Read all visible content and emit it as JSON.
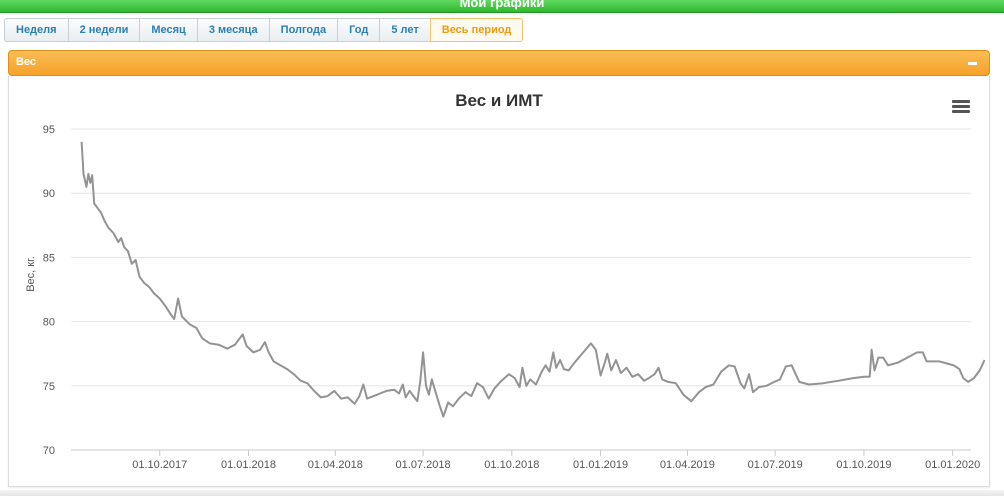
{
  "header": {
    "title": "Мои графики"
  },
  "tabs": [
    {
      "label": "Неделя"
    },
    {
      "label": "2 недели"
    },
    {
      "label": "Месяц"
    },
    {
      "label": "3 месяца"
    },
    {
      "label": "Полгода"
    },
    {
      "label": "Год"
    },
    {
      "label": "5 лет"
    },
    {
      "label": "Весь период",
      "active": true
    }
  ],
  "panel": {
    "title": "Вес"
  },
  "menu_icon": "hamburger-menu-icon",
  "colors": {
    "accent": "#f5a229",
    "topbar": "#3cc43c",
    "line": "#939393",
    "tab_text": "#2a7fb5"
  },
  "chart_data": {
    "type": "line",
    "title": "Вес и ИМТ",
    "xlabel": "",
    "ylabel": "Вес, кг.",
    "ylim": [
      70,
      95
    ],
    "yticks": [
      70,
      75,
      80,
      85,
      90,
      95
    ],
    "xlim": [
      "2017-07-01",
      "2020-01-20"
    ],
    "xticks": [
      "01.10.2017",
      "01.01.2018",
      "01.04.2018",
      "01.07.2018",
      "01.10.2018",
      "01.01.2019",
      "01.04.2019",
      "01.07.2019",
      "01.10.2019",
      "01.01.2020"
    ],
    "grid": true,
    "legend": "none",
    "series": [
      {
        "points": [
          [
            "2017-07-12",
            94.0
          ],
          [
            "2017-07-14",
            91.5
          ],
          [
            "2017-07-17",
            90.5
          ],
          [
            "2017-07-19",
            91.5
          ],
          [
            "2017-07-21",
            90.8
          ],
          [
            "2017-07-23",
            91.4
          ],
          [
            "2017-07-25",
            89.2
          ],
          [
            "2017-07-28",
            88.9
          ],
          [
            "2017-08-01",
            88.5
          ],
          [
            "2017-08-05",
            87.8
          ],
          [
            "2017-08-09",
            87.3
          ],
          [
            "2017-08-14",
            86.9
          ],
          [
            "2017-08-19",
            86.2
          ],
          [
            "2017-08-22",
            86.5
          ],
          [
            "2017-08-25",
            85.8
          ],
          [
            "2017-08-29",
            85.5
          ],
          [
            "2017-09-02",
            84.5
          ],
          [
            "2017-09-06",
            84.8
          ],
          [
            "2017-09-10",
            83.5
          ],
          [
            "2017-09-15",
            83.0
          ],
          [
            "2017-09-20",
            82.7
          ],
          [
            "2017-09-25",
            82.2
          ],
          [
            "2017-10-01",
            81.8
          ],
          [
            "2017-10-07",
            81.2
          ],
          [
            "2017-10-13",
            80.5
          ],
          [
            "2017-10-16",
            80.2
          ],
          [
            "2017-10-20",
            81.8
          ],
          [
            "2017-10-24",
            80.4
          ],
          [
            "2017-11-01",
            79.8
          ],
          [
            "2017-11-08",
            79.5
          ],
          [
            "2017-11-14",
            78.7
          ],
          [
            "2017-11-22",
            78.3
          ],
          [
            "2017-12-01",
            78.2
          ],
          [
            "2017-12-10",
            77.9
          ],
          [
            "2017-12-18",
            78.2
          ],
          [
            "2017-12-26",
            79.0
          ],
          [
            "2017-12-30",
            78.1
          ],
          [
            "2018-01-06",
            77.6
          ],
          [
            "2018-01-13",
            77.8
          ],
          [
            "2018-01-18",
            78.4
          ],
          [
            "2018-01-22",
            77.6
          ],
          [
            "2018-01-27",
            76.9
          ],
          [
            "2018-02-03",
            76.6
          ],
          [
            "2018-02-10",
            76.3
          ],
          [
            "2018-02-17",
            75.9
          ],
          [
            "2018-02-24",
            75.4
          ],
          [
            "2018-03-03",
            75.2
          ],
          [
            "2018-03-10",
            74.6
          ],
          [
            "2018-03-17",
            74.1
          ],
          [
            "2018-03-24",
            74.2
          ],
          [
            "2018-03-31",
            74.6
          ],
          [
            "2018-04-07",
            74.0
          ],
          [
            "2018-04-14",
            74.1
          ],
          [
            "2018-04-21",
            73.6
          ],
          [
            "2018-04-26",
            74.2
          ],
          [
            "2018-04-30",
            75.1
          ],
          [
            "2018-05-04",
            74.0
          ],
          [
            "2018-05-14",
            74.3
          ],
          [
            "2018-05-24",
            74.6
          ],
          [
            "2018-06-01",
            74.7
          ],
          [
            "2018-06-06",
            74.4
          ],
          [
            "2018-06-10",
            75.1
          ],
          [
            "2018-06-13",
            74.1
          ],
          [
            "2018-06-17",
            74.6
          ],
          [
            "2018-06-22",
            74.1
          ],
          [
            "2018-06-25",
            73.8
          ],
          [
            "2018-06-28",
            75.3
          ],
          [
            "2018-07-01",
            77.6
          ],
          [
            "2018-07-04",
            75.0
          ],
          [
            "2018-07-07",
            74.3
          ],
          [
            "2018-07-10",
            75.5
          ],
          [
            "2018-07-14",
            74.5
          ],
          [
            "2018-07-18",
            73.5
          ],
          [
            "2018-07-22",
            72.6
          ],
          [
            "2018-07-27",
            73.7
          ],
          [
            "2018-08-01",
            73.4
          ],
          [
            "2018-08-07",
            74.0
          ],
          [
            "2018-08-14",
            74.5
          ],
          [
            "2018-08-20",
            74.2
          ],
          [
            "2018-08-26",
            75.2
          ],
          [
            "2018-09-01",
            74.9
          ],
          [
            "2018-09-07",
            74.0
          ],
          [
            "2018-09-13",
            74.8
          ],
          [
            "2018-09-19",
            75.3
          ],
          [
            "2018-09-28",
            75.9
          ],
          [
            "2018-10-04",
            75.6
          ],
          [
            "2018-10-09",
            74.9
          ],
          [
            "2018-10-12",
            76.4
          ],
          [
            "2018-10-16",
            75.0
          ],
          [
            "2018-10-20",
            75.5
          ],
          [
            "2018-10-26",
            75.1
          ],
          [
            "2018-11-01",
            76.1
          ],
          [
            "2018-11-05",
            76.6
          ],
          [
            "2018-11-09",
            76.1
          ],
          [
            "2018-11-13",
            77.6
          ],
          [
            "2018-11-16",
            76.4
          ],
          [
            "2018-11-20",
            77.0
          ],
          [
            "2018-11-24",
            76.3
          ],
          [
            "2018-11-29",
            76.2
          ],
          [
            "2018-12-05",
            76.8
          ],
          [
            "2018-12-14",
            77.6
          ],
          [
            "2018-12-22",
            78.3
          ],
          [
            "2018-12-27",
            77.8
          ],
          [
            "2019-01-01",
            75.8
          ],
          [
            "2019-01-05",
            76.7
          ],
          [
            "2019-01-08",
            77.5
          ],
          [
            "2019-01-12",
            76.2
          ],
          [
            "2019-01-17",
            77.0
          ],
          [
            "2019-01-22",
            76.0
          ],
          [
            "2019-01-28",
            76.4
          ],
          [
            "2019-02-03",
            75.7
          ],
          [
            "2019-02-09",
            75.9
          ],
          [
            "2019-02-15",
            75.4
          ],
          [
            "2019-02-20",
            75.6
          ],
          [
            "2019-02-26",
            75.9
          ],
          [
            "2019-03-02",
            76.4
          ],
          [
            "2019-03-06",
            75.5
          ],
          [
            "2019-03-12",
            75.3
          ],
          [
            "2019-03-20",
            75.2
          ],
          [
            "2019-03-28",
            74.3
          ],
          [
            "2019-04-05",
            73.8
          ],
          [
            "2019-04-13",
            74.5
          ],
          [
            "2019-04-20",
            74.9
          ],
          [
            "2019-04-28",
            75.1
          ],
          [
            "2019-05-06",
            76.1
          ],
          [
            "2019-05-14",
            76.6
          ],
          [
            "2019-05-20",
            76.5
          ],
          [
            "2019-05-26",
            75.2
          ],
          [
            "2019-05-30",
            74.8
          ],
          [
            "2019-06-04",
            75.9
          ],
          [
            "2019-06-08",
            74.5
          ],
          [
            "2019-06-14",
            74.9
          ],
          [
            "2019-06-22",
            75.0
          ],
          [
            "2019-06-30",
            75.3
          ],
          [
            "2019-07-06",
            75.5
          ],
          [
            "2019-07-12",
            76.5
          ],
          [
            "2019-07-18",
            76.6
          ],
          [
            "2019-07-26",
            75.3
          ],
          [
            "2019-08-05",
            75.1
          ],
          [
            "2019-08-20",
            75.2
          ],
          [
            "2019-09-05",
            75.4
          ],
          [
            "2019-09-20",
            75.6
          ],
          [
            "2019-10-01",
            75.7
          ],
          [
            "2019-10-07",
            75.7
          ],
          [
            "2019-10-09",
            77.8
          ],
          [
            "2019-10-12",
            76.2
          ],
          [
            "2019-10-16",
            77.2
          ],
          [
            "2019-10-21",
            77.2
          ],
          [
            "2019-10-26",
            76.6
          ],
          [
            "2019-11-05",
            76.8
          ],
          [
            "2019-11-15",
            77.2
          ],
          [
            "2019-11-25",
            77.6
          ],
          [
            "2019-12-01",
            77.6
          ],
          [
            "2019-12-05",
            76.9
          ],
          [
            "2019-12-18",
            76.9
          ],
          [
            "2019-12-28",
            76.7
          ],
          [
            "2020-01-02",
            76.6
          ],
          [
            "2020-01-08",
            76.3
          ],
          [
            "2020-01-12",
            75.6
          ],
          [
            "2020-01-17",
            75.3
          ],
          [
            "2020-01-23",
            75.6
          ],
          [
            "2020-01-29",
            76.2
          ],
          [
            "2020-02-03",
            77.0
          ]
        ]
      }
    ]
  }
}
